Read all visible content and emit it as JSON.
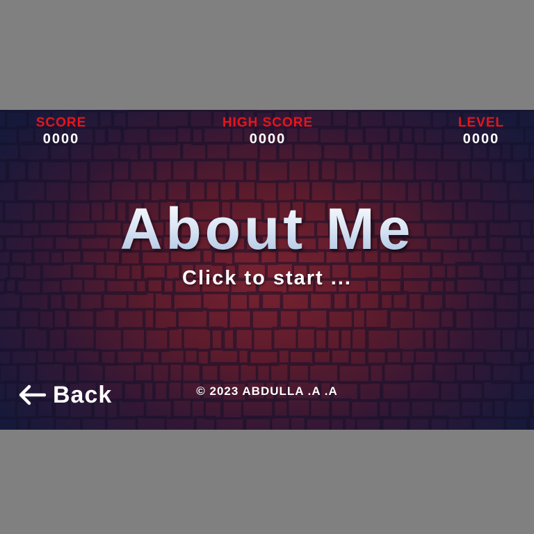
{
  "hud": {
    "score_label": "SCORE",
    "score_value": "0000",
    "high_score_label": "HIGH SCORE",
    "high_score_value": "0000",
    "level_label": "LEVEL",
    "level_value": "0000"
  },
  "title": "About Me",
  "subtitle": "Click to start ...",
  "back": {
    "icon": "arrow-left-icon",
    "label": "Back"
  },
  "footer": {
    "copyright": "© 2023 ABDULLA .A .A"
  },
  "colors": {
    "hud_label": "#e8141c",
    "text": "#ffffff",
    "title": "#dde8f6",
    "background_center": "#7a2230",
    "background_edge": "#17193a",
    "page_background": "#808080"
  }
}
